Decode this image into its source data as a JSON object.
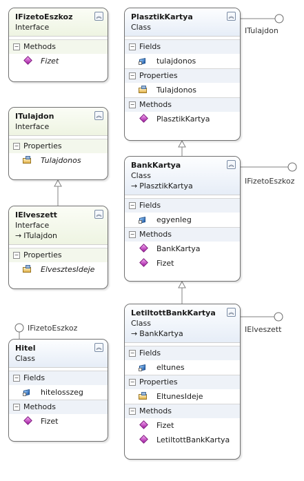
{
  "labels": {
    "interface": "Interface",
    "class": "Class",
    "fields": "Fields",
    "properties": "Properties",
    "methods": "Methods",
    "base_arrow": "→"
  },
  "shapes": {
    "ifizeto": {
      "name": "IFizetoEszkoz",
      "methods": [
        "Fizet"
      ]
    },
    "itulajdon": {
      "name": "ITulajdon",
      "properties": [
        "Tulajdonos"
      ]
    },
    "ielveszett": {
      "name": "IElveszett",
      "base": "ITulajdon",
      "properties": [
        "ElvesztesIdeje"
      ]
    },
    "hitel": {
      "name": "Hitel",
      "fields": [
        "hitelosszeg"
      ],
      "methods": [
        "Fizet"
      ]
    },
    "plasztik": {
      "name": "PlasztikKartya",
      "fields": [
        "tulajdonos"
      ],
      "properties": [
        "Tulajdonos"
      ],
      "methods": [
        "PlasztikKartya"
      ]
    },
    "bank": {
      "name": "BankKartya",
      "base": "PlasztikKartya",
      "fields": [
        "egyenleg"
      ],
      "methods": [
        "BankKartya",
        "Fizet"
      ]
    },
    "letiltott": {
      "name": "LetiltottBankKartya",
      "base": "BankKartya",
      "fields": [
        "eltunes"
      ],
      "properties": [
        "EltunesIdeje"
      ],
      "methods": [
        "Fizet",
        "LetiltottBankKartya"
      ]
    }
  },
  "lollipops": {
    "plasztik": "ITulajdon",
    "bank": "IFizetoEszkoz",
    "letiltott": "IElveszett",
    "hitel": "IFizetoEszkoz"
  }
}
